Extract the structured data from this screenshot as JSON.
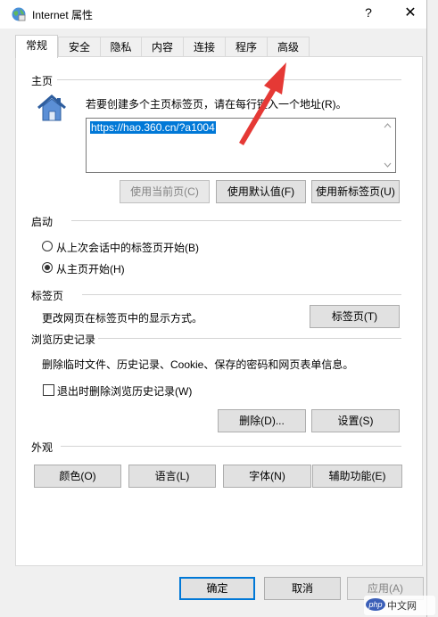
{
  "window": {
    "title": "Internet 属性",
    "help_glyph": "?",
    "close_glyph": "✕"
  },
  "tabs": [
    "常规",
    "安全",
    "隐私",
    "内容",
    "连接",
    "程序",
    "高级"
  ],
  "home": {
    "section": "主页",
    "instruction": "若要创建多个主页标签页，请在每行键入一个地址(R)。",
    "url": "https://hao.360.cn/?a1004",
    "buttons": {
      "use_current": "使用当前页(C)",
      "use_default": "使用默认值(F)",
      "use_new_tab": "使用新标签页(U)"
    }
  },
  "startup": {
    "section": "启动",
    "options": [
      "从上次会话中的标签页开始(B)",
      "从主页开始(H)"
    ],
    "selected_index": 1
  },
  "tabs_section": {
    "section": "标签页",
    "description": "更改网页在标签页中的显示方式。",
    "button": "标签页(T)"
  },
  "history": {
    "section": "浏览历史记录",
    "description": "删除临时文件、历史记录、Cookie、保存的密码和网页表单信息。",
    "checkbox": "退出时删除浏览历史记录(W)",
    "checked": false,
    "delete_button": "删除(D)...",
    "settings_button": "设置(S)"
  },
  "appearance": {
    "section": "外观",
    "buttons": [
      "颜色(O)",
      "语言(L)",
      "字体(N)",
      "辅助功能(E)"
    ]
  },
  "dialog_buttons": {
    "ok": "确定",
    "cancel": "取消",
    "apply": "应用(A)"
  },
  "watermark": "php中文网",
  "colors": {
    "accent": "#0078d7",
    "arrow": "#e53935",
    "panel_bg": "#ffffff",
    "window_bg": "#f0f0f0"
  }
}
